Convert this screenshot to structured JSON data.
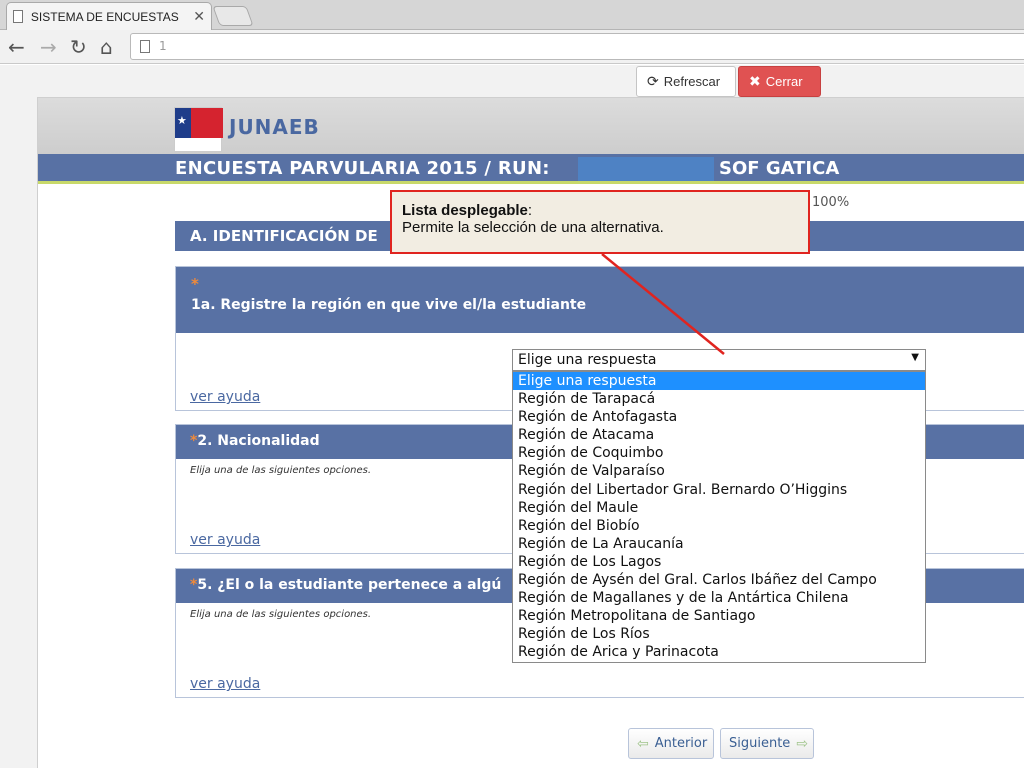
{
  "browser": {
    "tab_title": "SISTEMA DE ENCUESTAS -",
    "tab_close": "✕",
    "url": "1"
  },
  "top_buttons": {
    "refresh_label": "Refrescar",
    "close_label": "Cerrar"
  },
  "header": {
    "brand": "JUNAEB",
    "logo_text": "JUNAEB",
    "title": "ENCUESTA PARVULARIA 2015 / RUN:",
    "name": "SOF GATICA",
    "progress": "100%"
  },
  "section": {
    "label": "A. IDENTIFICACIÓN DE"
  },
  "questions": [
    {
      "star": "*",
      "text": "1a. Registre la región en que vive el/la estudiante",
      "help": "ver ayuda"
    },
    {
      "star": "*",
      "text": "2. Nacionalidad",
      "sub": "Elija una de las siguientes opciones.",
      "help": "ver ayuda"
    },
    {
      "star": "*",
      "text": "5. ¿El o la estudiante pertenece a algú",
      "sub": "Elija una de las siguientes opciones.",
      "help": "ver ayuda"
    }
  ],
  "dropdown": {
    "value": "Elige una respuesta",
    "options": [
      "Elige una respuesta",
      "Región de Tarapacá",
      "Región de Antofagasta",
      "Región de Atacama",
      "Región de Coquimbo",
      "Región de Valparaíso",
      "Región del Libertador Gral. Bernardo O’Higgins",
      "Región del Maule",
      "Región del Biobío",
      "Región de La Araucanía",
      "Región de Los Lagos",
      "Región de Aysén del Gral. Carlos Ibáñez del Campo",
      "Región de Magallanes y de la Antártica Chilena",
      "Región Metropolitana de Santiago",
      "Región de Los Ríos",
      "Región de Arica y Parinacota"
    ],
    "selected_index": 0
  },
  "callout": {
    "title": "Lista desplegable",
    "body": "Permite la selección de una alternativa."
  },
  "footer_nav": {
    "prev_label": "Anterior",
    "next_label": "Siguiente"
  },
  "colors": {
    "header_blue": "#5871a4",
    "accent_orange": "#f08a3a",
    "close_red": "#e05252",
    "callout_border": "#e0241f",
    "selected_option": "#1e90ff"
  }
}
